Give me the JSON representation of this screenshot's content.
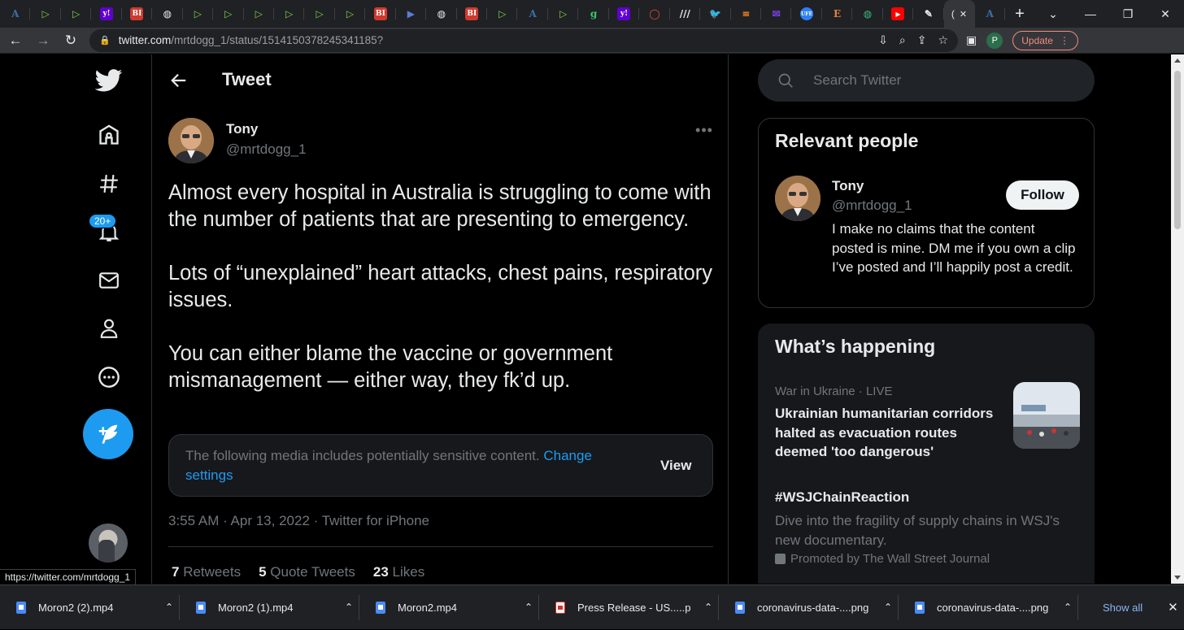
{
  "browser": {
    "tabs": [
      {
        "icon": "a-serif",
        "color": "#3b6ea8",
        "glyph": "A"
      },
      {
        "icon": "play",
        "color": "#7bd04a",
        "glyph": "▷"
      },
      {
        "icon": "play",
        "color": "#7bd04a",
        "glyph": "▷"
      },
      {
        "icon": "yahoo",
        "color": "#6001d2",
        "glyph": "y!"
      },
      {
        "icon": "bi",
        "color": "#d0392e",
        "glyph": "BI"
      },
      {
        "icon": "globe",
        "color": "#e8eaed",
        "glyph": "◍"
      },
      {
        "icon": "play",
        "color": "#7bd04a",
        "glyph": "▷"
      },
      {
        "icon": "play",
        "color": "#7bd04a",
        "glyph": "▷"
      },
      {
        "icon": "play",
        "color": "#7bd04a",
        "glyph": "▷"
      },
      {
        "icon": "play",
        "color": "#7bd04a",
        "glyph": "▷"
      },
      {
        "icon": "play",
        "color": "#7bd04a",
        "glyph": "▷"
      },
      {
        "icon": "play",
        "color": "#7bd04a",
        "glyph": "▷"
      },
      {
        "icon": "bi",
        "color": "#d0392e",
        "glyph": "BI"
      },
      {
        "icon": "flag",
        "color": "#5a7bd6",
        "glyph": "▶"
      },
      {
        "icon": "globe",
        "color": "#e8eaed",
        "glyph": "◍"
      },
      {
        "icon": "bi",
        "color": "#d0392e",
        "glyph": "BI"
      },
      {
        "icon": "play",
        "color": "#7bd04a",
        "glyph": "▷"
      },
      {
        "icon": "a-serif",
        "color": "#3b6ea8",
        "glyph": "A"
      },
      {
        "icon": "play",
        "color": "#7bd04a",
        "glyph": "▷"
      },
      {
        "icon": "g",
        "color": "#37c871",
        "glyph": "g"
      },
      {
        "icon": "yahoo",
        "color": "#6001d2",
        "glyph": "y!"
      },
      {
        "icon": "chat",
        "color": "#e94c3c",
        "glyph": "◯"
      },
      {
        "icon": "lines",
        "color": "#e8eaed",
        "glyph": "///"
      },
      {
        "icon": "twitter",
        "color": "#1d9bf0",
        "glyph": "🐦"
      },
      {
        "icon": "stack",
        "color": "#f48024",
        "glyph": "≡"
      },
      {
        "icon": "mail",
        "color": "#7b3fe4",
        "glyph": "✉"
      },
      {
        "icon": "ufe",
        "color": "#2d7ff9",
        "glyph": "UFE"
      },
      {
        "icon": "e",
        "color": "#e8813a",
        "glyph": "E"
      },
      {
        "icon": "globe",
        "color": "#3bba7c",
        "glyph": "◍"
      },
      {
        "icon": "youtube",
        "color": "#ff0000",
        "glyph": "▶"
      },
      {
        "icon": "pen",
        "color": "#e8eaed",
        "glyph": "✎"
      }
    ],
    "active_tab": {
      "label": "(",
      "close": "✕"
    },
    "last_tab": {
      "icon": "a-serif",
      "color": "#3b6ea8",
      "glyph": "A"
    },
    "new_tab": "+",
    "url_host": "twitter.com",
    "url_path": "/mrtdogg_1/status/1514150378245341185?",
    "profile_initial": "P",
    "update_label": "Update",
    "status_url": "https://twitter.com/mrtdogg_1"
  },
  "nav": {
    "notifications_badge": "20+"
  },
  "header": {
    "title": "Tweet"
  },
  "tweet": {
    "author_name": "Tony",
    "author_handle": "@mrtdogg_1",
    "paragraphs": [
      "Almost every hospital in Australia is struggling to come with the number of patients that are presenting to emergency.",
      "Lots of “unexplained” heart attacks, chest pains, respiratory issues.",
      "You can either blame the vaccine or government mismanagement — either way, they fk’d up."
    ],
    "sensitive_text": "The following media includes potentially sensitive content.",
    "sensitive_link": "Change settings",
    "view_label": "View",
    "timestamp": "3:55 AM · Apr 13, 2022 · Twitter for iPhone",
    "retweets_count": "7",
    "retweets_label": "Retweets",
    "quotes_count": "5",
    "quotes_label": "Quote Tweets",
    "likes_count": "23",
    "likes_label": "Likes"
  },
  "search": {
    "placeholder": "Search Twitter"
  },
  "relevant_people": {
    "title": "Relevant people",
    "name": "Tony",
    "handle": "@mrtdogg_1",
    "follow_label": "Follow",
    "bio": "I make no claims that the content posted is mine. DM me if you own a clip I’ve posted and I’ll happily post a credit."
  },
  "whats_happening": {
    "title": "What’s happening",
    "trend1_meta": "War in Ukraine · LIVE",
    "trend1_title": "Ukrainian humanitarian corridors halted as evacuation routes deemed 'too dangerous'",
    "trend2_title": "#WSJChainReaction",
    "trend2_desc": "Dive into the fragility of supply chains in WSJ's new documentary.",
    "trend2_promo": "Promoted by The Wall Street Journal"
  },
  "downloads": {
    "items": [
      {
        "name": "Moron2 (2).mp4",
        "type": "doc"
      },
      {
        "name": "Moron2 (1).mp4",
        "type": "doc"
      },
      {
        "name": "Moron2.mp4",
        "type": "doc"
      },
      {
        "name": "Press Release - US.....pdf",
        "type": "pdf"
      },
      {
        "name": "coronavirus-data-....png",
        "type": "doc"
      },
      {
        "name": "coronavirus-data-....png",
        "type": "doc"
      }
    ],
    "show_all_label": "Show all",
    "close": "✕"
  }
}
